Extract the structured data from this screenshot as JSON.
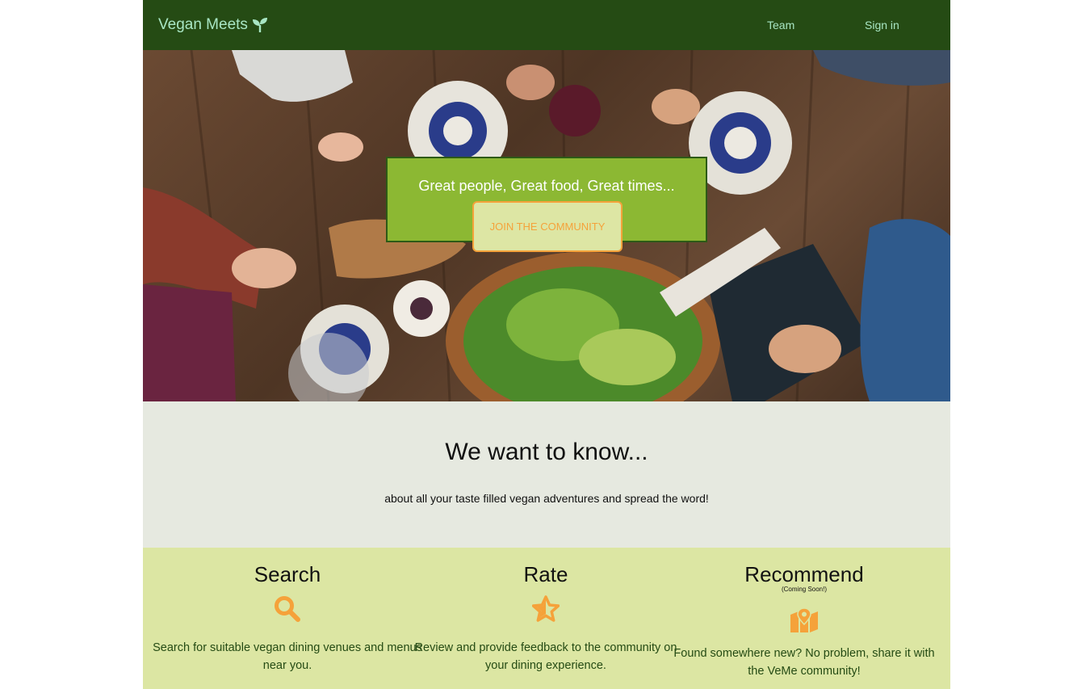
{
  "nav": {
    "brand": "Vegan Meets",
    "brand_icon": "seedling-icon",
    "links": [
      "Team",
      "Sign in"
    ]
  },
  "hero": {
    "tagline": "Great people, Great food, Great times...",
    "cta": "JOIN THE COMMUNITY"
  },
  "know": {
    "heading": "We want to know...",
    "text": "about all your taste filled vegan adventures and spread the word!"
  },
  "features": [
    {
      "title": "Search",
      "icon": "search-icon",
      "text": "Search for suitable vegan dining venues and menus near you."
    },
    {
      "title": "Rate",
      "icon": "star-icon",
      "text": "Review and provide feedback to the community on your dining experience."
    },
    {
      "title": "Recommend",
      "note": "(Coming Soon!)",
      "icon": "map-marker-icon",
      "text": "Found somewhere new? No problem, share it with the VeMe community!"
    }
  ],
  "colors": {
    "navbar": "#254b14",
    "nav_text": "#a8e6c4",
    "hero_box": "#8cb833",
    "accent_orange": "#f5a23a",
    "know_bg": "#e6e9e0",
    "features_bg": "#dce6a3"
  }
}
